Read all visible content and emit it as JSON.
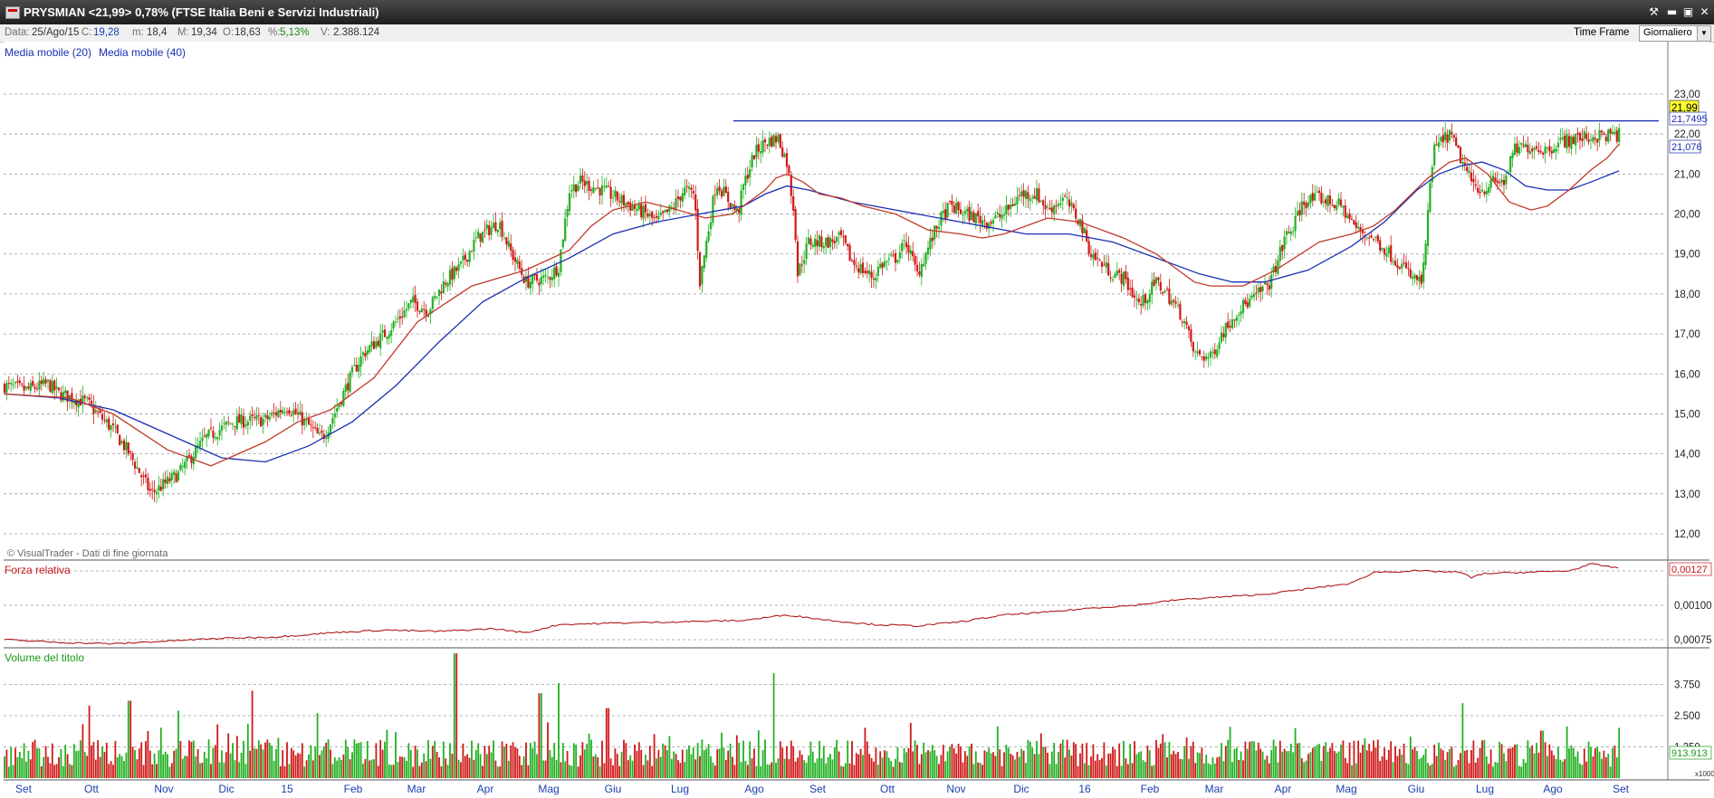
{
  "window": {
    "title": "PRYSMIAN <21,99> 0,78%  (FTSE Italia Beni e Servizi Industriali)",
    "controls": [
      "pin-icon",
      "minimize-icon",
      "maximize-icon",
      "close-icon"
    ]
  },
  "infobar": {
    "date_label": "Data:",
    "date_value": "25/Ago/15",
    "close_label": "C:",
    "close_value": "19,28",
    "min_label": "m:",
    "min_value": "18,4",
    "max_label": "M:",
    "max_value": "19,34",
    "open_label": "O:",
    "open_value": "18,63",
    "pct_label": "%:",
    "pct_value": "5,13%",
    "vol_label": "V:",
    "vol_value": "2.388.124",
    "timeframe_label": "Time Frame",
    "timeframe_value": "Giornaliero"
  },
  "colors": {
    "up_candle": "#22b022",
    "down_candle": "#d01818",
    "ma20": "#c0392b",
    "ma40": "#1a2fb0",
    "resistance": "#1a2fb0",
    "rs_line": "#b01818",
    "grid": "#9a9a9a"
  },
  "chart_data": [
    {
      "type": "candlestick",
      "legend": [
        "Media mobile (20)",
        "Media mobile (40)"
      ],
      "watermark": "© VisualTrader - Dati di fine giornata",
      "ylim": [
        11.4,
        23.4
      ],
      "yticks": [
        "23,00",
        "22,00",
        "21,00",
        "20,00",
        "19,00",
        "18,00",
        "17,00",
        "16,00",
        "15,00",
        "14,00",
        "13,00",
        "12,00"
      ],
      "last_price_label": "21,99",
      "ma20_label": "21,7495",
      "ma40_label": "21,076",
      "resistance_level": 22.33,
      "x_labels": [
        "Set",
        "Ott",
        "Nov",
        "Dic",
        "15",
        "Feb",
        "Mar",
        "Apr",
        "Mag",
        "Giu",
        "Lug",
        "Ago",
        "Set",
        "Ott",
        "Nov",
        "Dic",
        "16",
        "Feb",
        "Mar",
        "Apr",
        "Mag",
        "Giu",
        "Lug",
        "Ago",
        "Set"
      ],
      "price_path": {
        "x": [
          0,
          20,
          40,
          50,
          75,
          100,
          115,
          135,
          160,
          185,
          210,
          240,
          260,
          280,
          290,
          295,
          320,
          330,
          350,
          360,
          375,
          390,
          405,
          420,
          435,
          455,
          465,
          480,
          500,
          510,
          520,
          530,
          550,
          570,
          590,
          600,
          615,
          625,
          635,
          640,
          655,
          675,
          680,
          690,
          700,
          712,
          720,
          727,
          730,
          740,
          760,
          770,
          780,
          800,
          805,
          820,
          830,
          840,
          860,
          870,
          885,
          905,
          920,
          935,
          950,
          960,
          975,
          990,
          1000,
          1020,
          1030,
          1045,
          1060,
          1070,
          1085,
          1095,
          1110,
          1120,
          1135,
          1150,
          1165,
          1180,
          1185,
          1195,
          1210,
          1230,
          1245,
          1260,
          1275,
          1290,
          1295,
          1305,
          1315,
          1330,
          1340,
          1350,
          1360,
          1370,
          1380,
          1390,
          1405,
          1420,
          1430,
          1450,
          1470,
          1486
        ],
        "y": [
          15.7,
          15.6,
          15.75,
          15.5,
          15.3,
          14.6,
          14.0,
          13.0,
          13.5,
          14.4,
          14.8,
          14.85,
          15.2,
          14.7,
          14.4,
          14.5,
          16.0,
          16.5,
          17.0,
          17.3,
          17.8,
          17.6,
          18.3,
          18.7,
          19.4,
          19.8,
          19.1,
          18.3,
          18.4,
          18.7,
          20.6,
          20.8,
          20.6,
          20.3,
          20.0,
          19.8,
          20.15,
          20.6,
          20.5,
          18.3,
          20.8,
          20.0,
          20.7,
          21.5,
          21.8,
          21.9,
          21.3,
          20.0,
          18.5,
          19.3,
          19.3,
          19.4,
          18.8,
          18.4,
          18.7,
          18.9,
          19.3,
          18.5,
          19.8,
          20.2,
          20.0,
          19.8,
          20.0,
          20.5,
          20.5,
          20.1,
          20.4,
          19.8,
          19.0,
          18.5,
          18.4,
          17.7,
          18.3,
          18.0,
          17.4,
          16.5,
          16.4,
          17.0,
          17.6,
          17.9,
          18.3,
          19.5,
          19.6,
          20.3,
          20.4,
          20.2,
          19.6,
          19.4,
          19.0,
          18.6,
          18.4,
          18.3,
          21.6,
          22.0,
          21.4,
          20.8,
          20.6,
          20.8,
          20.8,
          21.6,
          21.7,
          21.6,
          21.8,
          21.9,
          21.95,
          21.99
        ]
      },
      "ma20_path": {
        "x": [
          0,
          60,
          100,
          150,
          190,
          240,
          270,
          300,
          340,
          380,
          430,
          480,
          520,
          540,
          560,
          590,
          620,
          645,
          670,
          690,
          700,
          710,
          720,
          735,
          750,
          770,
          790,
          820,
          850,
          880,
          900,
          920,
          960,
          990,
          1030,
          1060,
          1080,
          1095,
          1110,
          1140,
          1170,
          1210,
          1240,
          1260,
          1280,
          1295,
          1310,
          1330,
          1345,
          1365,
          1385,
          1405,
          1420,
          1440,
          1460,
          1475,
          1486
        ],
        "y": [
          15.5,
          15.4,
          15.0,
          14.1,
          13.7,
          14.3,
          14.8,
          15.1,
          15.9,
          17.3,
          18.2,
          18.6,
          19.1,
          19.7,
          20.1,
          20.3,
          20.1,
          19.9,
          20.0,
          20.4,
          20.6,
          20.9,
          21.0,
          20.8,
          20.5,
          20.4,
          20.2,
          20.0,
          19.6,
          19.5,
          19.4,
          19.5,
          19.9,
          19.8,
          19.4,
          19.0,
          18.6,
          18.3,
          18.2,
          18.2,
          18.6,
          19.3,
          19.5,
          19.7,
          20.1,
          20.5,
          20.9,
          21.3,
          21.4,
          21.0,
          20.3,
          20.1,
          20.2,
          20.6,
          21.1,
          21.4,
          21.75
        ]
      },
      "ma40_path": {
        "x": [
          0,
          50,
          100,
          150,
          200,
          240,
          280,
          320,
          360,
          400,
          440,
          480,
          520,
          560,
          600,
          640,
          680,
          700,
          720,
          740,
          780,
          820,
          860,
          900,
          940,
          980,
          1020,
          1060,
          1100,
          1130,
          1160,
          1200,
          1240,
          1270,
          1300,
          1320,
          1340,
          1360,
          1380,
          1400,
          1420,
          1440,
          1460,
          1486
        ],
        "y": [
          15.5,
          15.4,
          15.1,
          14.5,
          13.9,
          13.8,
          14.2,
          14.8,
          15.7,
          16.8,
          17.8,
          18.4,
          18.9,
          19.5,
          19.8,
          20.0,
          20.2,
          20.5,
          20.7,
          20.6,
          20.3,
          20.1,
          19.9,
          19.7,
          19.5,
          19.5,
          19.3,
          18.9,
          18.5,
          18.3,
          18.3,
          18.6,
          19.2,
          19.8,
          20.6,
          21.0,
          21.2,
          21.3,
          21.1,
          20.7,
          20.6,
          20.6,
          20.8,
          21.08
        ]
      }
    },
    {
      "type": "line",
      "legend": [
        "Forza relativa"
      ],
      "yticks": [
        "0,00125",
        "0,00100",
        "0,00075"
      ],
      "ylim": [
        0.00064,
        0.00132
      ],
      "last_label": "0,00127",
      "x": [
        0,
        50,
        100,
        150,
        200,
        250,
        300,
        350,
        400,
        450,
        480,
        510,
        560,
        620,
        680,
        720,
        760,
        800,
        840,
        880,
        920,
        960,
        1000,
        1040,
        1080,
        1120,
        1160,
        1200,
        1240,
        1260,
        1300,
        1340,
        1350,
        1360,
        1400,
        1440,
        1460,
        1486
      ],
      "y": [
        0.00075,
        0.00073,
        0.00072,
        0.00074,
        0.00076,
        0.00077,
        0.0008,
        0.00082,
        0.00081,
        0.00083,
        0.0008,
        0.00086,
        0.00087,
        0.00088,
        0.00089,
        0.00093,
        0.00089,
        0.00086,
        0.00085,
        0.00088,
        0.00093,
        0.00095,
        0.00098,
        0.001,
        0.00104,
        0.00106,
        0.00108,
        0.00112,
        0.00116,
        0.00124,
        0.00125,
        0.00124,
        0.0012,
        0.00123,
        0.00124,
        0.00125,
        0.0013,
        0.00127
      ]
    },
    {
      "type": "bar",
      "legend": [
        "Volume del titolo"
      ],
      "yticks": [
        "3.750",
        "2.500",
        "1.250"
      ],
      "unit_label": "x1000",
      "ylim": [
        0,
        5000
      ],
      "last_label": "913.913",
      "spikes": {
        "x": [
          78,
          115,
          160,
          228,
          288,
          415,
          493,
          510,
          555,
          708,
          1188,
          1342,
          1415
        ],
        "v": [
          2900,
          3100,
          2700,
          3500,
          2600,
          5000,
          3400,
          3800,
          2800,
          4200,
          2000,
          3000,
          1900
        ]
      }
    }
  ]
}
